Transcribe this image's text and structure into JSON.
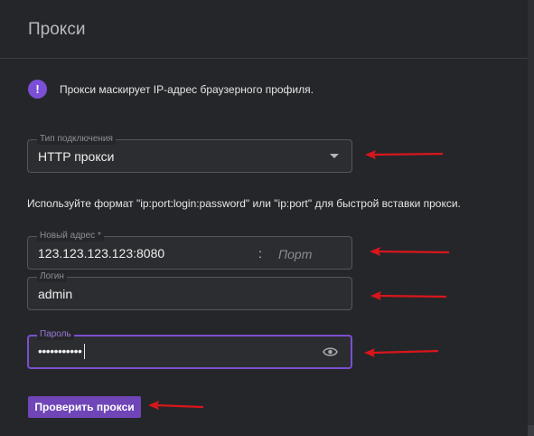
{
  "dialog": {
    "title": "Прокси",
    "info_text": "Прокси маскирует IP-адрес браузерного профиля.",
    "info_icon": "info-icon"
  },
  "connection_type": {
    "label": "Тип подключения",
    "value": "HTTP прокси"
  },
  "hint": "Используйте формат \"ip:port:login:password\" или \"ip:port\" для быстрой вставки прокси.",
  "address": {
    "label": "Новый адрес *",
    "value": "123.123.123.123:8080",
    "separator": ":",
    "port_placeholder": "Порт"
  },
  "login": {
    "label": "Логин",
    "value": "admin"
  },
  "password": {
    "label": "Пароль",
    "value": "•••••••••••"
  },
  "check_button": "Проверить прокси",
  "colors": {
    "accent": "#7b4fd6",
    "annotation_arrow": "#d8161b",
    "background": "#25262a"
  }
}
